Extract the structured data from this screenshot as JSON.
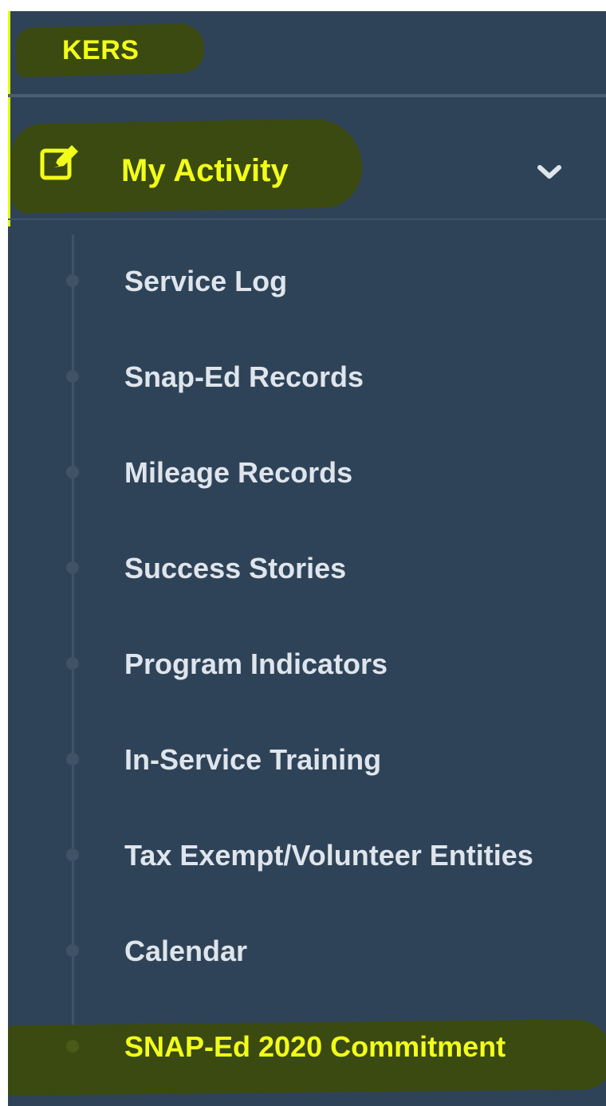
{
  "header": {
    "brand": "KERS"
  },
  "nav": {
    "section": {
      "label": "My Activity",
      "icon": "edit-icon",
      "expanded": true
    },
    "items": [
      {
        "label": "Service Log"
      },
      {
        "label": "Snap-Ed Records"
      },
      {
        "label": "Mileage Records"
      },
      {
        "label": "Success Stories"
      },
      {
        "label": "Program Indicators"
      },
      {
        "label": "In-Service Training"
      },
      {
        "label": "Tax Exempt/Volunteer Entities"
      },
      {
        "label": "Calendar"
      },
      {
        "label": "SNAP-Ed 2020 Commitment"
      }
    ],
    "active_item": "SNAP-Ed 2020 Commitment"
  },
  "colors": {
    "sidebar_bg": "#2f4358",
    "highlight": "#3a4a10",
    "accent_text": "#f2ff1a",
    "item_text": "#dfe5ec"
  }
}
